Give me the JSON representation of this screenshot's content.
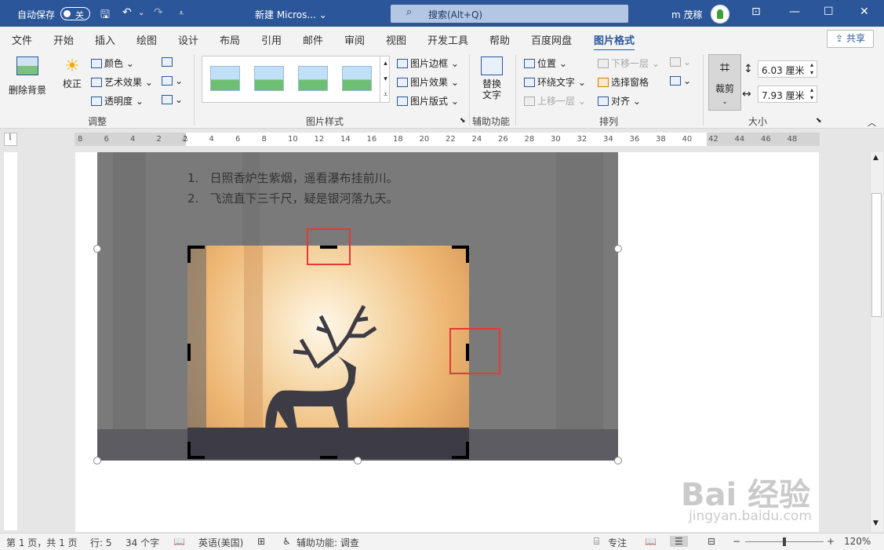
{
  "titlebar": {
    "autosave_label": "自动保存",
    "autosave_state": "关",
    "document_title": "新建 Micros...",
    "title_dropdown": "⌄",
    "search_placeholder": "搜索(Alt+Q)",
    "user_name": "m 茂稼"
  },
  "tabs": [
    "文件",
    "开始",
    "插入",
    "绘图",
    "设计",
    "布局",
    "引用",
    "邮件",
    "审阅",
    "视图",
    "开发工具",
    "帮助",
    "百度网盘",
    "图片格式"
  ],
  "share_label": "共享",
  "ribbon": {
    "adjust": {
      "remove_bg": "删除背景",
      "correct": "校正",
      "color": "颜色",
      "artistic": "艺术效果",
      "transparency": "透明度",
      "group_label": "调整"
    },
    "styles": {
      "border": "图片边框",
      "effects": "图片效果",
      "layout": "图片版式",
      "group_label": "图片样式"
    },
    "accessibility": {
      "alt_text_line1": "替换",
      "alt_text_line2": "文字",
      "group_label": "辅助功能"
    },
    "arrange": {
      "position": "位置",
      "wrap_text": "环绕文字",
      "bring_forward": "上移一层",
      "send_backward": "下移一层",
      "selection_pane": "选择窗格",
      "align": "对齐",
      "group_label": "排列"
    },
    "size": {
      "crop": "裁剪",
      "height": "6.03 厘米",
      "width": "7.93 厘米",
      "group_label": "大小"
    }
  },
  "ruler_numbers": [
    "8",
    "6",
    "4",
    "2",
    "2",
    "4",
    "6",
    "8",
    "10",
    "12",
    "14",
    "16",
    "18",
    "20",
    "22",
    "24",
    "26",
    "28",
    "30",
    "32",
    "34",
    "36",
    "38",
    "40",
    "42",
    "44",
    "46",
    "48"
  ],
  "document": {
    "list": [
      {
        "num": "1.",
        "text": "日照香炉生紫烟，遥看瀑布挂前川。"
      },
      {
        "num": "2.",
        "text": "飞流直下三千尺，疑是银河落九天。"
      }
    ]
  },
  "statusbar": {
    "page": "第 1 页，共 1 页",
    "line": "行: 5",
    "words": "34 个字",
    "language": "英语(美国)",
    "accessibility": "辅助功能: 调查",
    "focus": "专注",
    "zoom": "120%"
  },
  "watermark": {
    "brand": "Bai 经验",
    "url": "jingyan.baidu.com"
  },
  "colors": {
    "accent": "#2b579a",
    "highlight_box": "#e53935"
  }
}
